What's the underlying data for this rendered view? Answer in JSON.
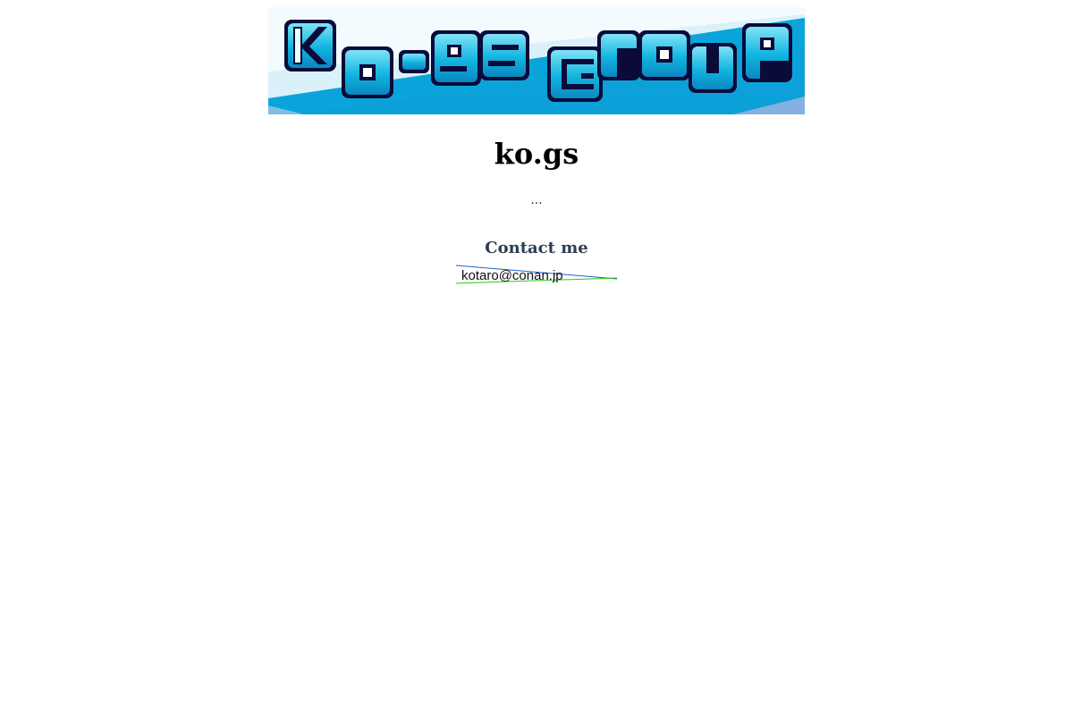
{
  "banner": {
    "logo_text": "ko-gs group",
    "colors": {
      "primary": "#09a6dc",
      "outline": "#0b0b3a",
      "highlight": "#ffffff"
    }
  },
  "site_title": "ko.gs",
  "tagline": "...",
  "contact": {
    "heading": "Contact me",
    "email_image_text": "kotaro@conan.jp"
  }
}
